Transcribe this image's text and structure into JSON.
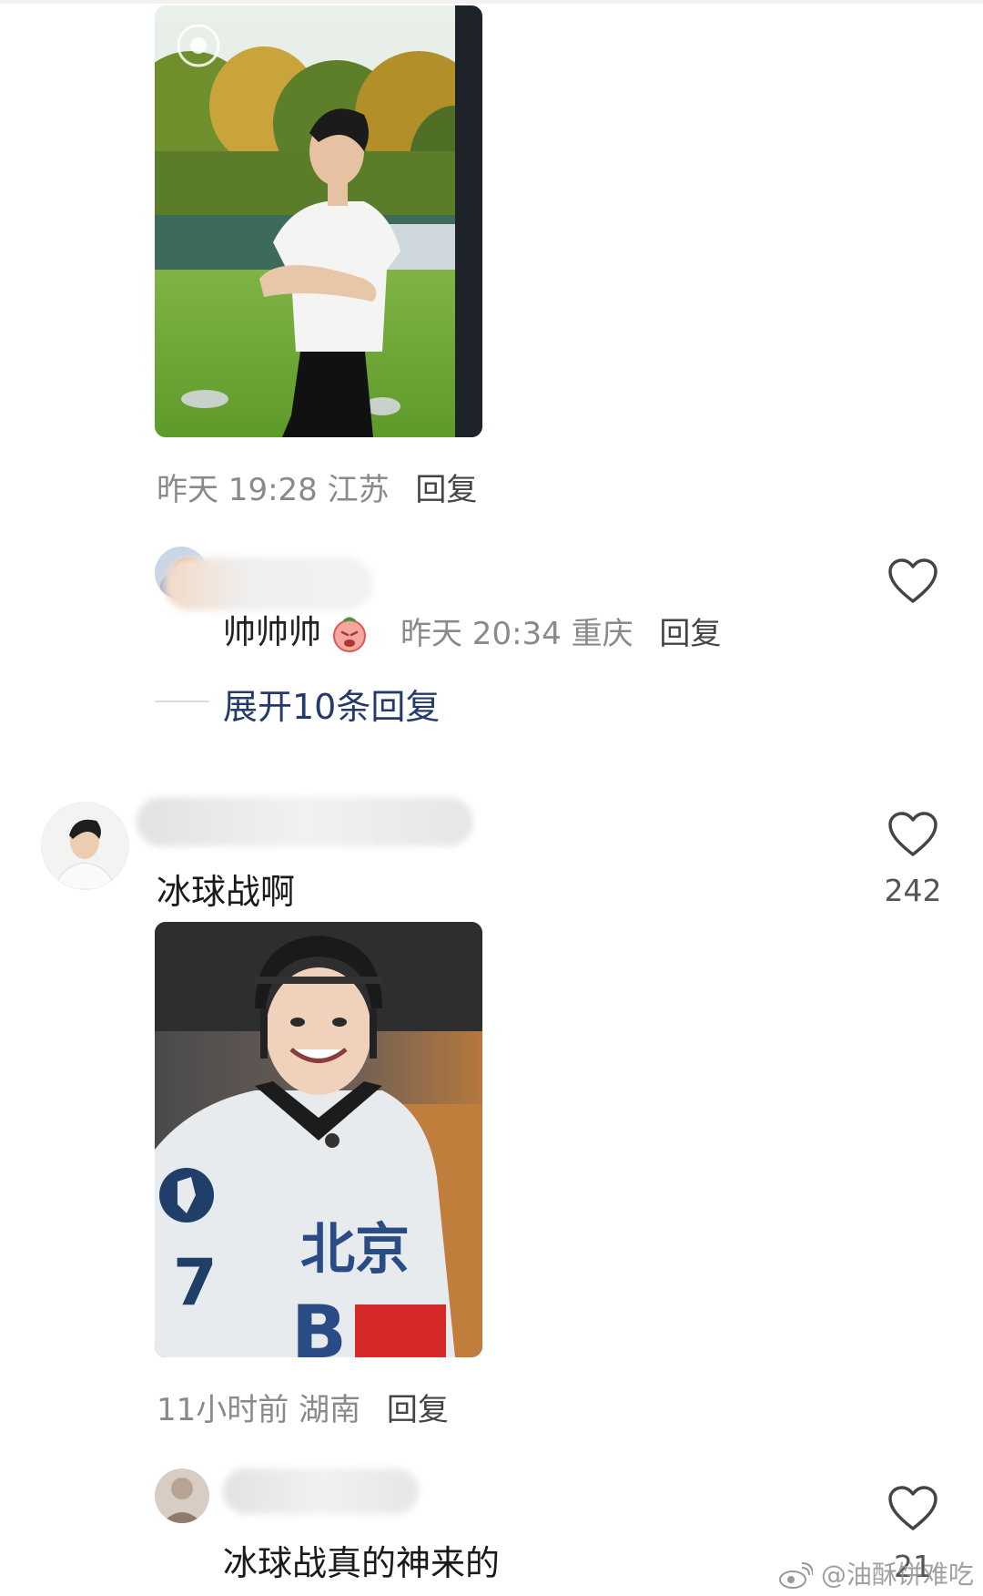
{
  "comments": [
    {
      "meta": {
        "time": "昨天 19:28",
        "location": "江苏",
        "reply": "回复"
      }
    },
    {
      "name_suffix": "帅帅帅",
      "meta": {
        "time": "昨天 20:34",
        "location": "重庆",
        "reply": "回复"
      },
      "expand_label": "展开10条回复"
    },
    {
      "text": "冰球战啊",
      "likes": "242",
      "meta": {
        "time": "11小时前",
        "location": "湖南",
        "reply": "回复"
      }
    },
    {
      "text": "冰球战真的神来的",
      "likes": "21"
    }
  ],
  "watermark": "@油酥饼难吃",
  "colors": {
    "expand": "#243a6b",
    "meta": "#8a8a8a"
  }
}
